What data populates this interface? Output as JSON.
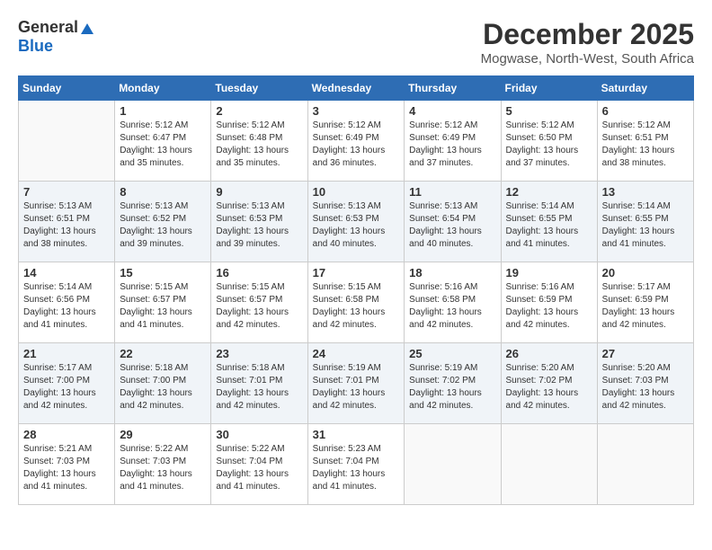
{
  "header": {
    "logo_general": "General",
    "logo_blue": "Blue",
    "month_title": "December 2025",
    "location": "Mogwase, North-West, South Africa"
  },
  "weekdays": [
    "Sunday",
    "Monday",
    "Tuesday",
    "Wednesday",
    "Thursday",
    "Friday",
    "Saturday"
  ],
  "weeks": [
    [
      {
        "day": "",
        "info": ""
      },
      {
        "day": "1",
        "info": "Sunrise: 5:12 AM\nSunset: 6:47 PM\nDaylight: 13 hours\nand 35 minutes."
      },
      {
        "day": "2",
        "info": "Sunrise: 5:12 AM\nSunset: 6:48 PM\nDaylight: 13 hours\nand 35 minutes."
      },
      {
        "day": "3",
        "info": "Sunrise: 5:12 AM\nSunset: 6:49 PM\nDaylight: 13 hours\nand 36 minutes."
      },
      {
        "day": "4",
        "info": "Sunrise: 5:12 AM\nSunset: 6:49 PM\nDaylight: 13 hours\nand 37 minutes."
      },
      {
        "day": "5",
        "info": "Sunrise: 5:12 AM\nSunset: 6:50 PM\nDaylight: 13 hours\nand 37 minutes."
      },
      {
        "day": "6",
        "info": "Sunrise: 5:12 AM\nSunset: 6:51 PM\nDaylight: 13 hours\nand 38 minutes."
      }
    ],
    [
      {
        "day": "7",
        "info": "Sunrise: 5:13 AM\nSunset: 6:51 PM\nDaylight: 13 hours\nand 38 minutes."
      },
      {
        "day": "8",
        "info": "Sunrise: 5:13 AM\nSunset: 6:52 PM\nDaylight: 13 hours\nand 39 minutes."
      },
      {
        "day": "9",
        "info": "Sunrise: 5:13 AM\nSunset: 6:53 PM\nDaylight: 13 hours\nand 39 minutes."
      },
      {
        "day": "10",
        "info": "Sunrise: 5:13 AM\nSunset: 6:53 PM\nDaylight: 13 hours\nand 40 minutes."
      },
      {
        "day": "11",
        "info": "Sunrise: 5:13 AM\nSunset: 6:54 PM\nDaylight: 13 hours\nand 40 minutes."
      },
      {
        "day": "12",
        "info": "Sunrise: 5:14 AM\nSunset: 6:55 PM\nDaylight: 13 hours\nand 41 minutes."
      },
      {
        "day": "13",
        "info": "Sunrise: 5:14 AM\nSunset: 6:55 PM\nDaylight: 13 hours\nand 41 minutes."
      }
    ],
    [
      {
        "day": "14",
        "info": "Sunrise: 5:14 AM\nSunset: 6:56 PM\nDaylight: 13 hours\nand 41 minutes."
      },
      {
        "day": "15",
        "info": "Sunrise: 5:15 AM\nSunset: 6:57 PM\nDaylight: 13 hours\nand 41 minutes."
      },
      {
        "day": "16",
        "info": "Sunrise: 5:15 AM\nSunset: 6:57 PM\nDaylight: 13 hours\nand 42 minutes."
      },
      {
        "day": "17",
        "info": "Sunrise: 5:15 AM\nSunset: 6:58 PM\nDaylight: 13 hours\nand 42 minutes."
      },
      {
        "day": "18",
        "info": "Sunrise: 5:16 AM\nSunset: 6:58 PM\nDaylight: 13 hours\nand 42 minutes."
      },
      {
        "day": "19",
        "info": "Sunrise: 5:16 AM\nSunset: 6:59 PM\nDaylight: 13 hours\nand 42 minutes."
      },
      {
        "day": "20",
        "info": "Sunrise: 5:17 AM\nSunset: 6:59 PM\nDaylight: 13 hours\nand 42 minutes."
      }
    ],
    [
      {
        "day": "21",
        "info": "Sunrise: 5:17 AM\nSunset: 7:00 PM\nDaylight: 13 hours\nand 42 minutes."
      },
      {
        "day": "22",
        "info": "Sunrise: 5:18 AM\nSunset: 7:00 PM\nDaylight: 13 hours\nand 42 minutes."
      },
      {
        "day": "23",
        "info": "Sunrise: 5:18 AM\nSunset: 7:01 PM\nDaylight: 13 hours\nand 42 minutes."
      },
      {
        "day": "24",
        "info": "Sunrise: 5:19 AM\nSunset: 7:01 PM\nDaylight: 13 hours\nand 42 minutes."
      },
      {
        "day": "25",
        "info": "Sunrise: 5:19 AM\nSunset: 7:02 PM\nDaylight: 13 hours\nand 42 minutes."
      },
      {
        "day": "26",
        "info": "Sunrise: 5:20 AM\nSunset: 7:02 PM\nDaylight: 13 hours\nand 42 minutes."
      },
      {
        "day": "27",
        "info": "Sunrise: 5:20 AM\nSunset: 7:03 PM\nDaylight: 13 hours\nand 42 minutes."
      }
    ],
    [
      {
        "day": "28",
        "info": "Sunrise: 5:21 AM\nSunset: 7:03 PM\nDaylight: 13 hours\nand 41 minutes."
      },
      {
        "day": "29",
        "info": "Sunrise: 5:22 AM\nSunset: 7:03 PM\nDaylight: 13 hours\nand 41 minutes."
      },
      {
        "day": "30",
        "info": "Sunrise: 5:22 AM\nSunset: 7:04 PM\nDaylight: 13 hours\nand 41 minutes."
      },
      {
        "day": "31",
        "info": "Sunrise: 5:23 AM\nSunset: 7:04 PM\nDaylight: 13 hours\nand 41 minutes."
      },
      {
        "day": "",
        "info": ""
      },
      {
        "day": "",
        "info": ""
      },
      {
        "day": "",
        "info": ""
      }
    ]
  ]
}
